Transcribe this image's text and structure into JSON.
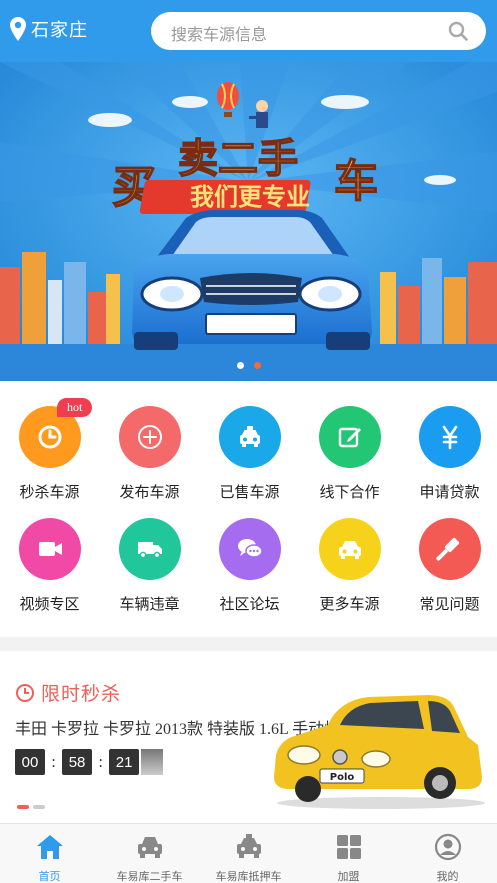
{
  "header": {
    "city": "石家庄",
    "search_placeholder": "搜索车源信息"
  },
  "banner": {
    "headline_top": "卖二手",
    "headline_left": "买",
    "headline_right": "车",
    "slogan": "我们更专业",
    "plate": "",
    "slide_count": 2,
    "active_slide": 1
  },
  "grid": {
    "items": [
      {
        "label": "秒杀车源",
        "icon": "clock-icon",
        "color": "#ff9a1f",
        "badge": "hot"
      },
      {
        "label": "发布车源",
        "icon": "plus-circle-icon",
        "color": "#f46a6a"
      },
      {
        "label": "已售车源",
        "icon": "taxi-icon",
        "color": "#1ba8e8"
      },
      {
        "label": "线下合作",
        "icon": "edit-icon",
        "color": "#22c674"
      },
      {
        "label": "申请贷款",
        "icon": "yen-icon",
        "color": "#1a9cf0"
      },
      {
        "label": "视频专区",
        "icon": "video-icon",
        "color": "#f14aa6"
      },
      {
        "label": "车辆违章",
        "icon": "truck-icon",
        "color": "#22c69b"
      },
      {
        "label": "社区论坛",
        "icon": "chat-icon",
        "color": "#a66cf0"
      },
      {
        "label": "更多车源",
        "icon": "car-icon",
        "color": "#f7d21a"
      },
      {
        "label": "常见问题",
        "icon": "gavel-icon",
        "color": "#f35a54"
      }
    ]
  },
  "sale": {
    "title": "限时秒杀",
    "description": "丰田 卡罗拉 卡罗拉 2013款 特装版 1.6L 手动炫酷型GL",
    "countdown": {
      "hours": "00",
      "minutes": "58",
      "seconds": "21"
    },
    "plate_text": "Polo",
    "page_count": 2,
    "active_page": 0
  },
  "tabbar": {
    "tabs": [
      {
        "label": "首页",
        "icon": "home-icon",
        "active": true
      },
      {
        "label": "车易库二手车",
        "icon": "car-front-icon",
        "active": false
      },
      {
        "label": "车易库抵押车",
        "icon": "taxi-front-icon",
        "active": false
      },
      {
        "label": "加盟",
        "icon": "grid-icon",
        "active": false
      },
      {
        "label": "我的",
        "icon": "user-icon",
        "active": false
      }
    ]
  },
  "colors": {
    "brand_blue": "#2f9bea",
    "accent_red": "#f06058"
  }
}
